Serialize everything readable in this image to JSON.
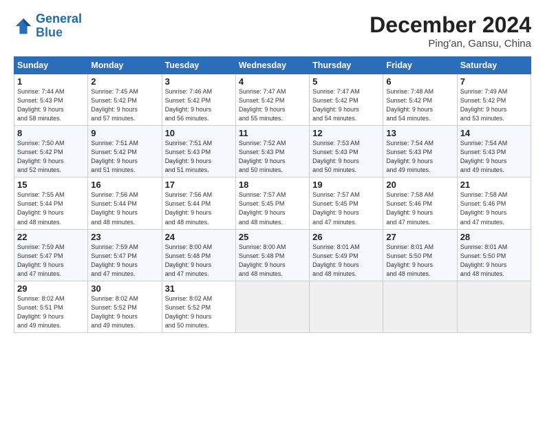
{
  "header": {
    "logo_line1": "General",
    "logo_line2": "Blue",
    "month_title": "December 2024",
    "location": "Ping'an, Gansu, China"
  },
  "weekdays": [
    "Sunday",
    "Monday",
    "Tuesday",
    "Wednesday",
    "Thursday",
    "Friday",
    "Saturday"
  ],
  "weeks": [
    [
      {
        "day": "1",
        "info": "Sunrise: 7:44 AM\nSunset: 5:43 PM\nDaylight: 9 hours\nand 58 minutes."
      },
      {
        "day": "2",
        "info": "Sunrise: 7:45 AM\nSunset: 5:42 PM\nDaylight: 9 hours\nand 57 minutes."
      },
      {
        "day": "3",
        "info": "Sunrise: 7:46 AM\nSunset: 5:42 PM\nDaylight: 9 hours\nand 56 minutes."
      },
      {
        "day": "4",
        "info": "Sunrise: 7:47 AM\nSunset: 5:42 PM\nDaylight: 9 hours\nand 55 minutes."
      },
      {
        "day": "5",
        "info": "Sunrise: 7:47 AM\nSunset: 5:42 PM\nDaylight: 9 hours\nand 54 minutes."
      },
      {
        "day": "6",
        "info": "Sunrise: 7:48 AM\nSunset: 5:42 PM\nDaylight: 9 hours\nand 54 minutes."
      },
      {
        "day": "7",
        "info": "Sunrise: 7:49 AM\nSunset: 5:42 PM\nDaylight: 9 hours\nand 53 minutes."
      }
    ],
    [
      {
        "day": "8",
        "info": "Sunrise: 7:50 AM\nSunset: 5:42 PM\nDaylight: 9 hours\nand 52 minutes."
      },
      {
        "day": "9",
        "info": "Sunrise: 7:51 AM\nSunset: 5:42 PM\nDaylight: 9 hours\nand 51 minutes."
      },
      {
        "day": "10",
        "info": "Sunrise: 7:51 AM\nSunset: 5:43 PM\nDaylight: 9 hours\nand 51 minutes."
      },
      {
        "day": "11",
        "info": "Sunrise: 7:52 AM\nSunset: 5:43 PM\nDaylight: 9 hours\nand 50 minutes."
      },
      {
        "day": "12",
        "info": "Sunrise: 7:53 AM\nSunset: 5:43 PM\nDaylight: 9 hours\nand 50 minutes."
      },
      {
        "day": "13",
        "info": "Sunrise: 7:54 AM\nSunset: 5:43 PM\nDaylight: 9 hours\nand 49 minutes."
      },
      {
        "day": "14",
        "info": "Sunrise: 7:54 AM\nSunset: 5:43 PM\nDaylight: 9 hours\nand 49 minutes."
      }
    ],
    [
      {
        "day": "15",
        "info": "Sunrise: 7:55 AM\nSunset: 5:44 PM\nDaylight: 9 hours\nand 48 minutes."
      },
      {
        "day": "16",
        "info": "Sunrise: 7:56 AM\nSunset: 5:44 PM\nDaylight: 9 hours\nand 48 minutes."
      },
      {
        "day": "17",
        "info": "Sunrise: 7:56 AM\nSunset: 5:44 PM\nDaylight: 9 hours\nand 48 minutes."
      },
      {
        "day": "18",
        "info": "Sunrise: 7:57 AM\nSunset: 5:45 PM\nDaylight: 9 hours\nand 48 minutes."
      },
      {
        "day": "19",
        "info": "Sunrise: 7:57 AM\nSunset: 5:45 PM\nDaylight: 9 hours\nand 47 minutes."
      },
      {
        "day": "20",
        "info": "Sunrise: 7:58 AM\nSunset: 5:46 PM\nDaylight: 9 hours\nand 47 minutes."
      },
      {
        "day": "21",
        "info": "Sunrise: 7:58 AM\nSunset: 5:46 PM\nDaylight: 9 hours\nand 47 minutes."
      }
    ],
    [
      {
        "day": "22",
        "info": "Sunrise: 7:59 AM\nSunset: 5:47 PM\nDaylight: 9 hours\nand 47 minutes."
      },
      {
        "day": "23",
        "info": "Sunrise: 7:59 AM\nSunset: 5:47 PM\nDaylight: 9 hours\nand 47 minutes."
      },
      {
        "day": "24",
        "info": "Sunrise: 8:00 AM\nSunset: 5:48 PM\nDaylight: 9 hours\nand 47 minutes."
      },
      {
        "day": "25",
        "info": "Sunrise: 8:00 AM\nSunset: 5:48 PM\nDaylight: 9 hours\nand 48 minutes."
      },
      {
        "day": "26",
        "info": "Sunrise: 8:01 AM\nSunset: 5:49 PM\nDaylight: 9 hours\nand 48 minutes."
      },
      {
        "day": "27",
        "info": "Sunrise: 8:01 AM\nSunset: 5:50 PM\nDaylight: 9 hours\nand 48 minutes."
      },
      {
        "day": "28",
        "info": "Sunrise: 8:01 AM\nSunset: 5:50 PM\nDaylight: 9 hours\nand 48 minutes."
      }
    ],
    [
      {
        "day": "29",
        "info": "Sunrise: 8:02 AM\nSunset: 5:51 PM\nDaylight: 9 hours\nand 49 minutes."
      },
      {
        "day": "30",
        "info": "Sunrise: 8:02 AM\nSunset: 5:52 PM\nDaylight: 9 hours\nand 49 minutes."
      },
      {
        "day": "31",
        "info": "Sunrise: 8:02 AM\nSunset: 5:52 PM\nDaylight: 9 hours\nand 50 minutes."
      },
      {
        "day": "",
        "info": ""
      },
      {
        "day": "",
        "info": ""
      },
      {
        "day": "",
        "info": ""
      },
      {
        "day": "",
        "info": ""
      }
    ]
  ]
}
